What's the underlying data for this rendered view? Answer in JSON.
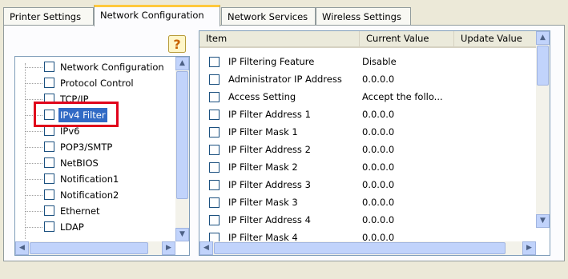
{
  "tabs": [
    {
      "label": "Printer Settings"
    },
    {
      "label": "Network Configuration"
    },
    {
      "label": "Network Services"
    },
    {
      "label": "Wireless Settings"
    }
  ],
  "tree": {
    "items": [
      {
        "label": "Network Configuration"
      },
      {
        "label": "Protocol Control"
      },
      {
        "label": "TCP/IP"
      },
      {
        "label": "IPv4 Filter"
      },
      {
        "label": "IPv6"
      },
      {
        "label": "POP3/SMTP"
      },
      {
        "label": "NetBIOS"
      },
      {
        "label": "Notification1"
      },
      {
        "label": "Notification2"
      },
      {
        "label": "Ethernet"
      },
      {
        "label": "LDAP"
      }
    ]
  },
  "list": {
    "columns": [
      "Item",
      "Current Value",
      "Update Value"
    ],
    "rows": [
      {
        "item": "IP Filtering Feature",
        "current": "Disable"
      },
      {
        "item": "Administrator IP Address",
        "current": "0.0.0.0"
      },
      {
        "item": "Access Setting",
        "current": "Accept the follo..."
      },
      {
        "item": "IP Filter Address 1",
        "current": "0.0.0.0"
      },
      {
        "item": "IP Filter Mask 1",
        "current": "0.0.0.0"
      },
      {
        "item": "IP Filter Address 2",
        "current": "0.0.0.0"
      },
      {
        "item": "IP Filter Mask 2",
        "current": "0.0.0.0"
      },
      {
        "item": "IP Filter Address 3",
        "current": "0.0.0.0"
      },
      {
        "item": "IP Filter Mask 3",
        "current": "0.0.0.0"
      },
      {
        "item": "IP Filter Address 4",
        "current": "0.0.0.0"
      },
      {
        "item": "IP Filter Mask 4",
        "current": "0.0.0.0"
      }
    ]
  },
  "icons": {
    "warning": "warning-icon",
    "scroll_up": "scroll-up-arrow-icon",
    "scroll_down": "scroll-down-arrow-icon",
    "scroll_left": "scroll-left-arrow-icon",
    "scroll_right": "scroll-right-arrow-icon"
  },
  "colors": {
    "highlight_border": "#E0001B",
    "selection": "#316AC5",
    "active_tab_accent": "#FFC83C",
    "window_bg": "#ECE9D8"
  }
}
